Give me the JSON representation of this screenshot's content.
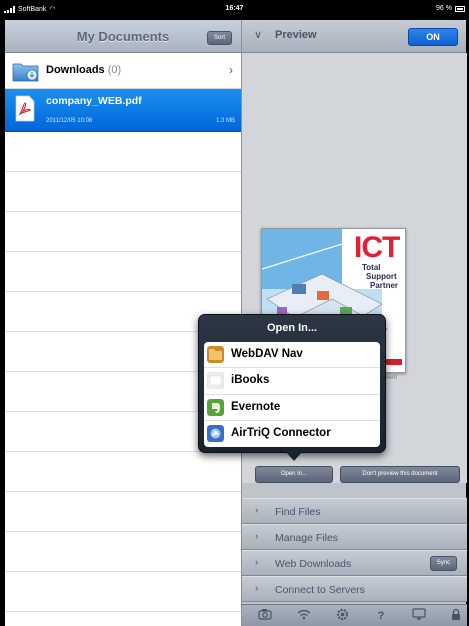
{
  "status_bar": {
    "carrier": "SoftBank",
    "time": "16:47",
    "battery": "96 %"
  },
  "documents": {
    "title": "My Documents",
    "sort_label": "Sort",
    "folder": {
      "name": "Downloads",
      "count": "(0)"
    },
    "selected_file": {
      "name": "company_WEB.pdf",
      "date": "2011/12/05 10:08",
      "size": "1.3 MB"
    }
  },
  "preview": {
    "title": "Preview",
    "toggle_label": "ON",
    "thumbnail_heading": "ICT",
    "thumbnail_subtitle": [
      "Total",
      "Support",
      "Partner"
    ],
    "thumbnail_caption": "ocument",
    "open_in_label": "Open In...",
    "dont_preview_label": "Don't preview this document"
  },
  "popover": {
    "title": "Open In...",
    "items": [
      {
        "label": "WebDAV Nav",
        "icon": "webdav-nav-icon",
        "color": "#c98a2a"
      },
      {
        "label": "iBooks",
        "icon": "ibooks-icon",
        "color": "#eeeeee"
      },
      {
        "label": "Evernote",
        "icon": "evernote-icon",
        "color": "#5aa33b"
      },
      {
        "label": "AirTriQ Connector",
        "icon": "airtriq-icon",
        "color": "#3a6fc0"
      }
    ]
  },
  "sections": [
    {
      "label": "Find Files"
    },
    {
      "label": "Manage Files"
    },
    {
      "label": "Web Downloads",
      "button": "Sync"
    },
    {
      "label": "Connect to Servers"
    }
  ],
  "toolbar": {
    "icons": [
      "camera-icon",
      "wifi-icon",
      "gear-icon",
      "help-icon",
      "screen-icon",
      "lock-icon"
    ]
  },
  "colors": {
    "selection": "#0a74e6",
    "toggle_on": "#1a6fdc",
    "popover_bg": "#222b37"
  }
}
